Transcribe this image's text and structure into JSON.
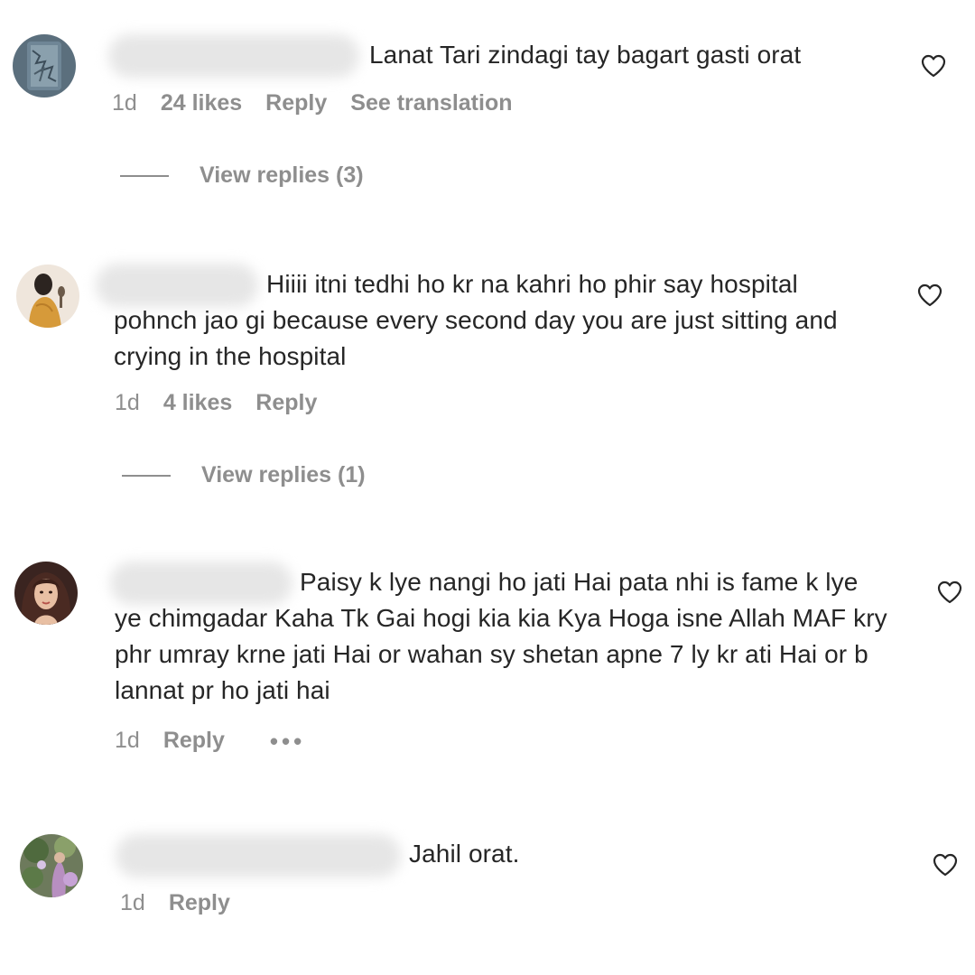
{
  "comments": [
    {
      "text": "Lanat Tari zindagi tay bagart gasti orat",
      "time": "1d",
      "likes": "24 likes",
      "reply": "Reply",
      "translate": "See translation",
      "view_replies": "View replies (3)"
    },
    {
      "text": "Hiiii itni tedhi ho kr na kahri ho phir say hospital pohnch jao gi because every second day you are just sitting and crying in the hospital",
      "time": "1d",
      "likes": "4 likes",
      "reply": "Reply",
      "view_replies": "View replies (1)"
    },
    {
      "text": "Paisy k lye nangi ho jati Hai pata nhi is fame k lye ye chimgadar Kaha Tk Gai hogi kia kia Kya Hoga isne Allah MAF kry phr umray krne jati Hai or wahan sy shetan apne 7 ly kr ati Hai or b lannat pr ho jati hai",
      "time": "1d",
      "reply": "Reply",
      "more": "•••"
    },
    {
      "text": "Jahil orat.",
      "time": "1d",
      "reply": "Reply"
    }
  ],
  "colors": {
    "text": "#262626",
    "secondary": "#8e8e8e",
    "background": "#ffffff"
  },
  "icons": {
    "like": "heart-outline-icon",
    "more": "more-horizontal-icon"
  }
}
